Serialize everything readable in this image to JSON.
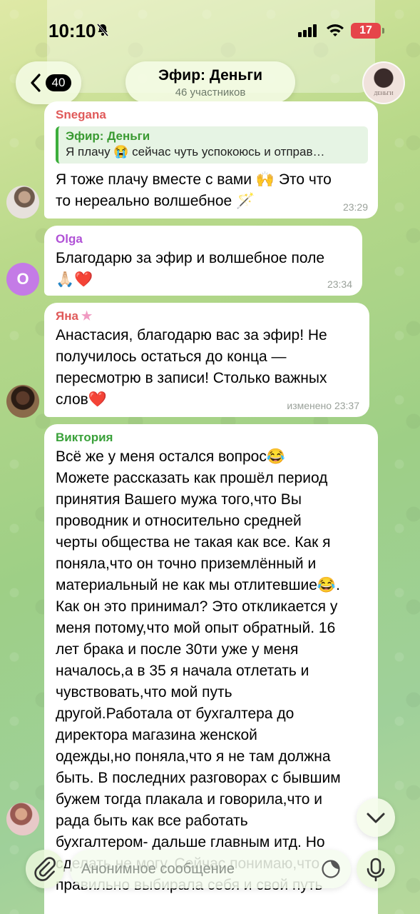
{
  "status_bar": {
    "time": "10:10",
    "battery": "17"
  },
  "header": {
    "back_count": "40",
    "title": "Эфир: Деньги",
    "subtitle": "46 участников",
    "avatar_caption": "ДЕНЬГИ"
  },
  "messages": [
    {
      "sender": "Snegana",
      "sender_color": "#e05a5a",
      "reply_title": "Эфир: Деньги",
      "reply_text": "Я плачу 😭 сейчас чуть успокоюсь и отправ…",
      "text": "Я тоже плачу вместе с вами 🙌 Это что\nто нереально волшебное 🪄",
      "time": "23:29"
    },
    {
      "sender": "Olga",
      "sender_color": "#b051d6",
      "avatar_letter": "O",
      "text": "Благодарю за эфир и волшебное поле\n🙏🏻❤️",
      "time": "23:34"
    },
    {
      "sender": "Яна",
      "sender_color": "#e05a5a",
      "sender_badge": "★",
      "text": "Анастасия, благодарю вас за эфир! Не\nполучилось остаться до конца —\nпересмотрю в записи! Столько важных\nслов❤️",
      "time": "изменено 23:37"
    },
    {
      "sender": "Виктория",
      "sender_color": "#3aa13a",
      "text": "Всё же у меня остался вопрос😂\nМожете рассказать как прошёл период\nпринятия Вашего мужа того,что Вы\nпроводник и относительно средней\nчерты общества не такая как все. Как я\nпоняла,что он точно приземлённый и\nматериальный не как мы отлитевшие😂.\nКак он это принимал? Это откликается у\nменя потому,что мой опыт обратный. 16\nлет брака и после 30ти уже у меня\nначалось,а в 35 я начала отлетать и\nчувствовать,что мой путь\nдругой.Работала от бухгалтера до\nдиректора магазина женской\nодежды,но поняла,что я не там должна\nбыть. В последних разговорах с бывшим\nбужем тогда плакала и говорила,что и\nрада быть как все работать\nбухгалтером- дальше главным итд. Но\nсделать не могу. Сейчас понимаю,что\nправильно выбирала себя и свой путь"
    }
  ],
  "composer": {
    "placeholder": "Анонимное сообщение"
  },
  "icons": {
    "back": "chevron-left-icon",
    "bell": "bell-slash-icon",
    "scroll": "chevron-down-icon",
    "attach": "paperclip-icon",
    "sticker": "sticker-icon",
    "mic": "microphone-icon"
  }
}
